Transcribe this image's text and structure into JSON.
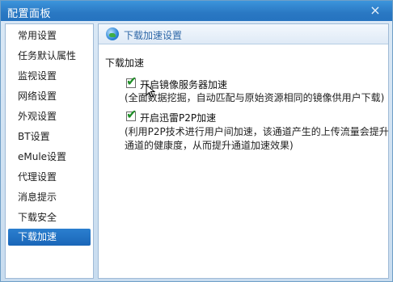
{
  "window": {
    "title": "配置面板",
    "close_glyph": "×"
  },
  "sidebar": {
    "items": [
      {
        "label": "常用设置"
      },
      {
        "label": "任务默认属性"
      },
      {
        "label": "监视设置"
      },
      {
        "label": "网络设置"
      },
      {
        "label": "外观设置"
      },
      {
        "label": "BT设置"
      },
      {
        "label": "eMule设置"
      },
      {
        "label": "代理设置"
      },
      {
        "label": "消息提示"
      },
      {
        "label": "下载安全"
      },
      {
        "label": "下载加速"
      }
    ],
    "active_index": 10
  },
  "content": {
    "header_icon": "globe-icon",
    "header_title": "下载加速设置",
    "group_title": "下载加速",
    "options": [
      {
        "label": "开启镜像服务器加速",
        "checked": true,
        "description_lines": [
          "(全面数据挖掘，自动匹配与原始资源相同的镜像供用户下载)"
        ]
      },
      {
        "label": "开启迅雷P2P加速",
        "checked": true,
        "description_lines": [
          "(利用P2P技术进行用户间加速，该通道产生的上传流量会提升",
          "通道的健康度，从而提升通道加速效果)"
        ]
      }
    ]
  },
  "colors": {
    "accent": "#2573bf",
    "active_item": "#1a66b8",
    "check": "#1f8f27"
  }
}
